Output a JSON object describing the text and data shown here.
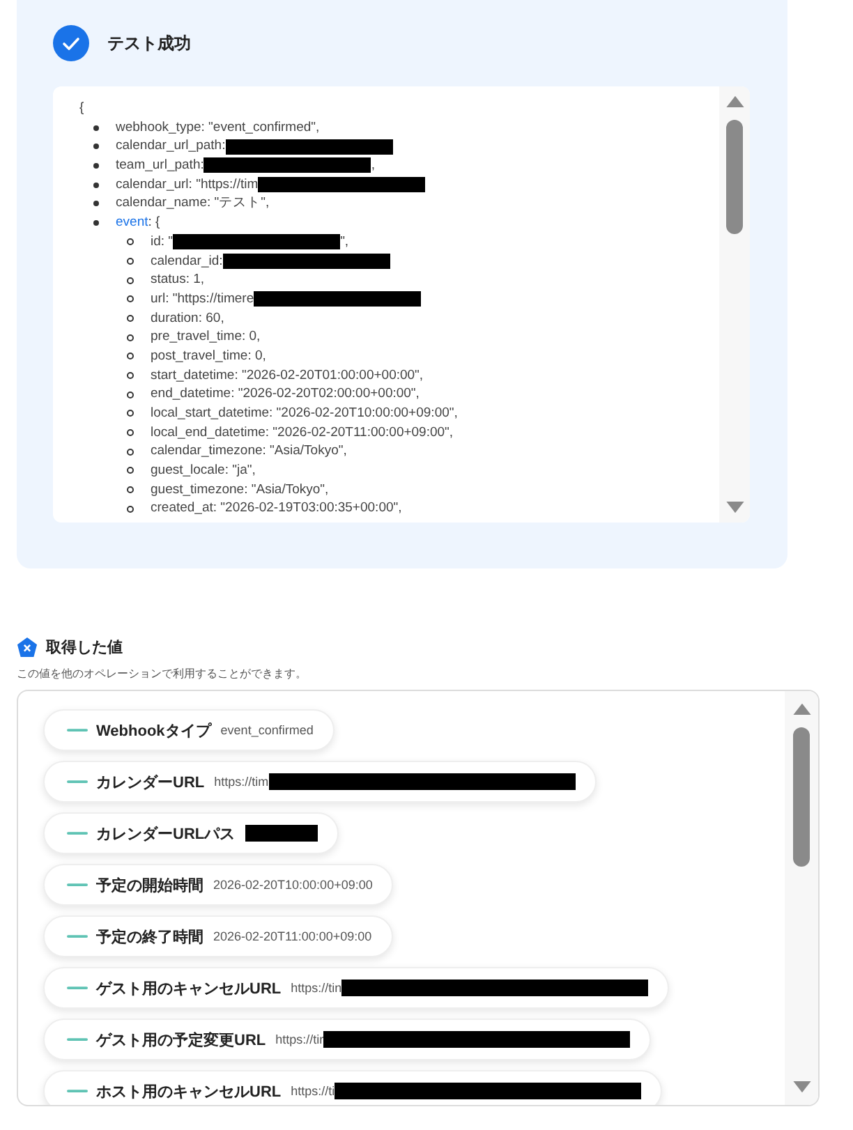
{
  "test_result": {
    "title": "テスト成功"
  },
  "code_view": {
    "open": "{",
    "items": [
      {
        "key": "webhook_type",
        "text": ": \"event_confirmed\","
      },
      {
        "key": "calendar_url_path",
        "text": ": ",
        "redacted": true
      },
      {
        "key": "team_url_path",
        "text": ":",
        "redacted": true,
        "after": ","
      },
      {
        "key": "calendar_url",
        "text": ": \"https://tim",
        "redacted": true
      },
      {
        "key": "calendar_name",
        "text": ": \"テスト\","
      },
      {
        "key": "event",
        "text": ": {",
        "link": true,
        "children": [
          {
            "key": "id",
            "text": ": \"",
            "redacted": true,
            "after": "\","
          },
          {
            "key": "calendar_id",
            "text": ": ",
            "redacted": true
          },
          {
            "key": "status",
            "text": ": 1,"
          },
          {
            "key": "url",
            "text": ": \"https://timere",
            "redacted": true
          },
          {
            "key": "duration",
            "text": ": 60,"
          },
          {
            "key": "pre_travel_time",
            "text": ": 0,"
          },
          {
            "key": "post_travel_time",
            "text": ": 0,"
          },
          {
            "key": "start_datetime",
            "text": ": \"2026-02-20T01:00:00+00:00\","
          },
          {
            "key": "end_datetime",
            "text": ": \"2026-02-20T02:00:00+00:00\","
          },
          {
            "key": "local_start_datetime",
            "text": ": \"2026-02-20T10:00:00+09:00\","
          },
          {
            "key": "local_end_datetime",
            "text": ": \"2026-02-20T11:00:00+09:00\","
          },
          {
            "key": "calendar_timezone",
            "text": ": \"Asia/Tokyo\","
          },
          {
            "key": "guest_locale",
            "text": ": \"ja\","
          },
          {
            "key": "guest_timezone",
            "text": ": \"Asia/Tokyo\","
          },
          {
            "key": "created_at",
            "text": ": \"2026-02-19T03:00:35+00:00\","
          }
        ]
      }
    ]
  },
  "values_section": {
    "title": "取得した値",
    "description": "この値を他のオペレーションで利用することができます。",
    "chips": [
      {
        "label": "Webhookタイプ",
        "value": "event_confirmed"
      },
      {
        "label": "カレンダーURL",
        "value": "https://tim",
        "redacted": true
      },
      {
        "label": "カレンダーURLパス",
        "redacted": true
      },
      {
        "label": "予定の開始時間",
        "value": "2026-02-20T10:00:00+09:00"
      },
      {
        "label": "予定の終了時間",
        "value": "2026-02-20T11:00:00+09:00"
      },
      {
        "label": "ゲスト用のキャンセルURL",
        "value": "https://tin",
        "redacted": true
      },
      {
        "label": "ゲスト用の予定変更URL",
        "value": "https://tir",
        "redacted": true
      },
      {
        "label": "ホスト用のキャンセルURL",
        "value": "https://ti",
        "redacted": true
      }
    ]
  }
}
